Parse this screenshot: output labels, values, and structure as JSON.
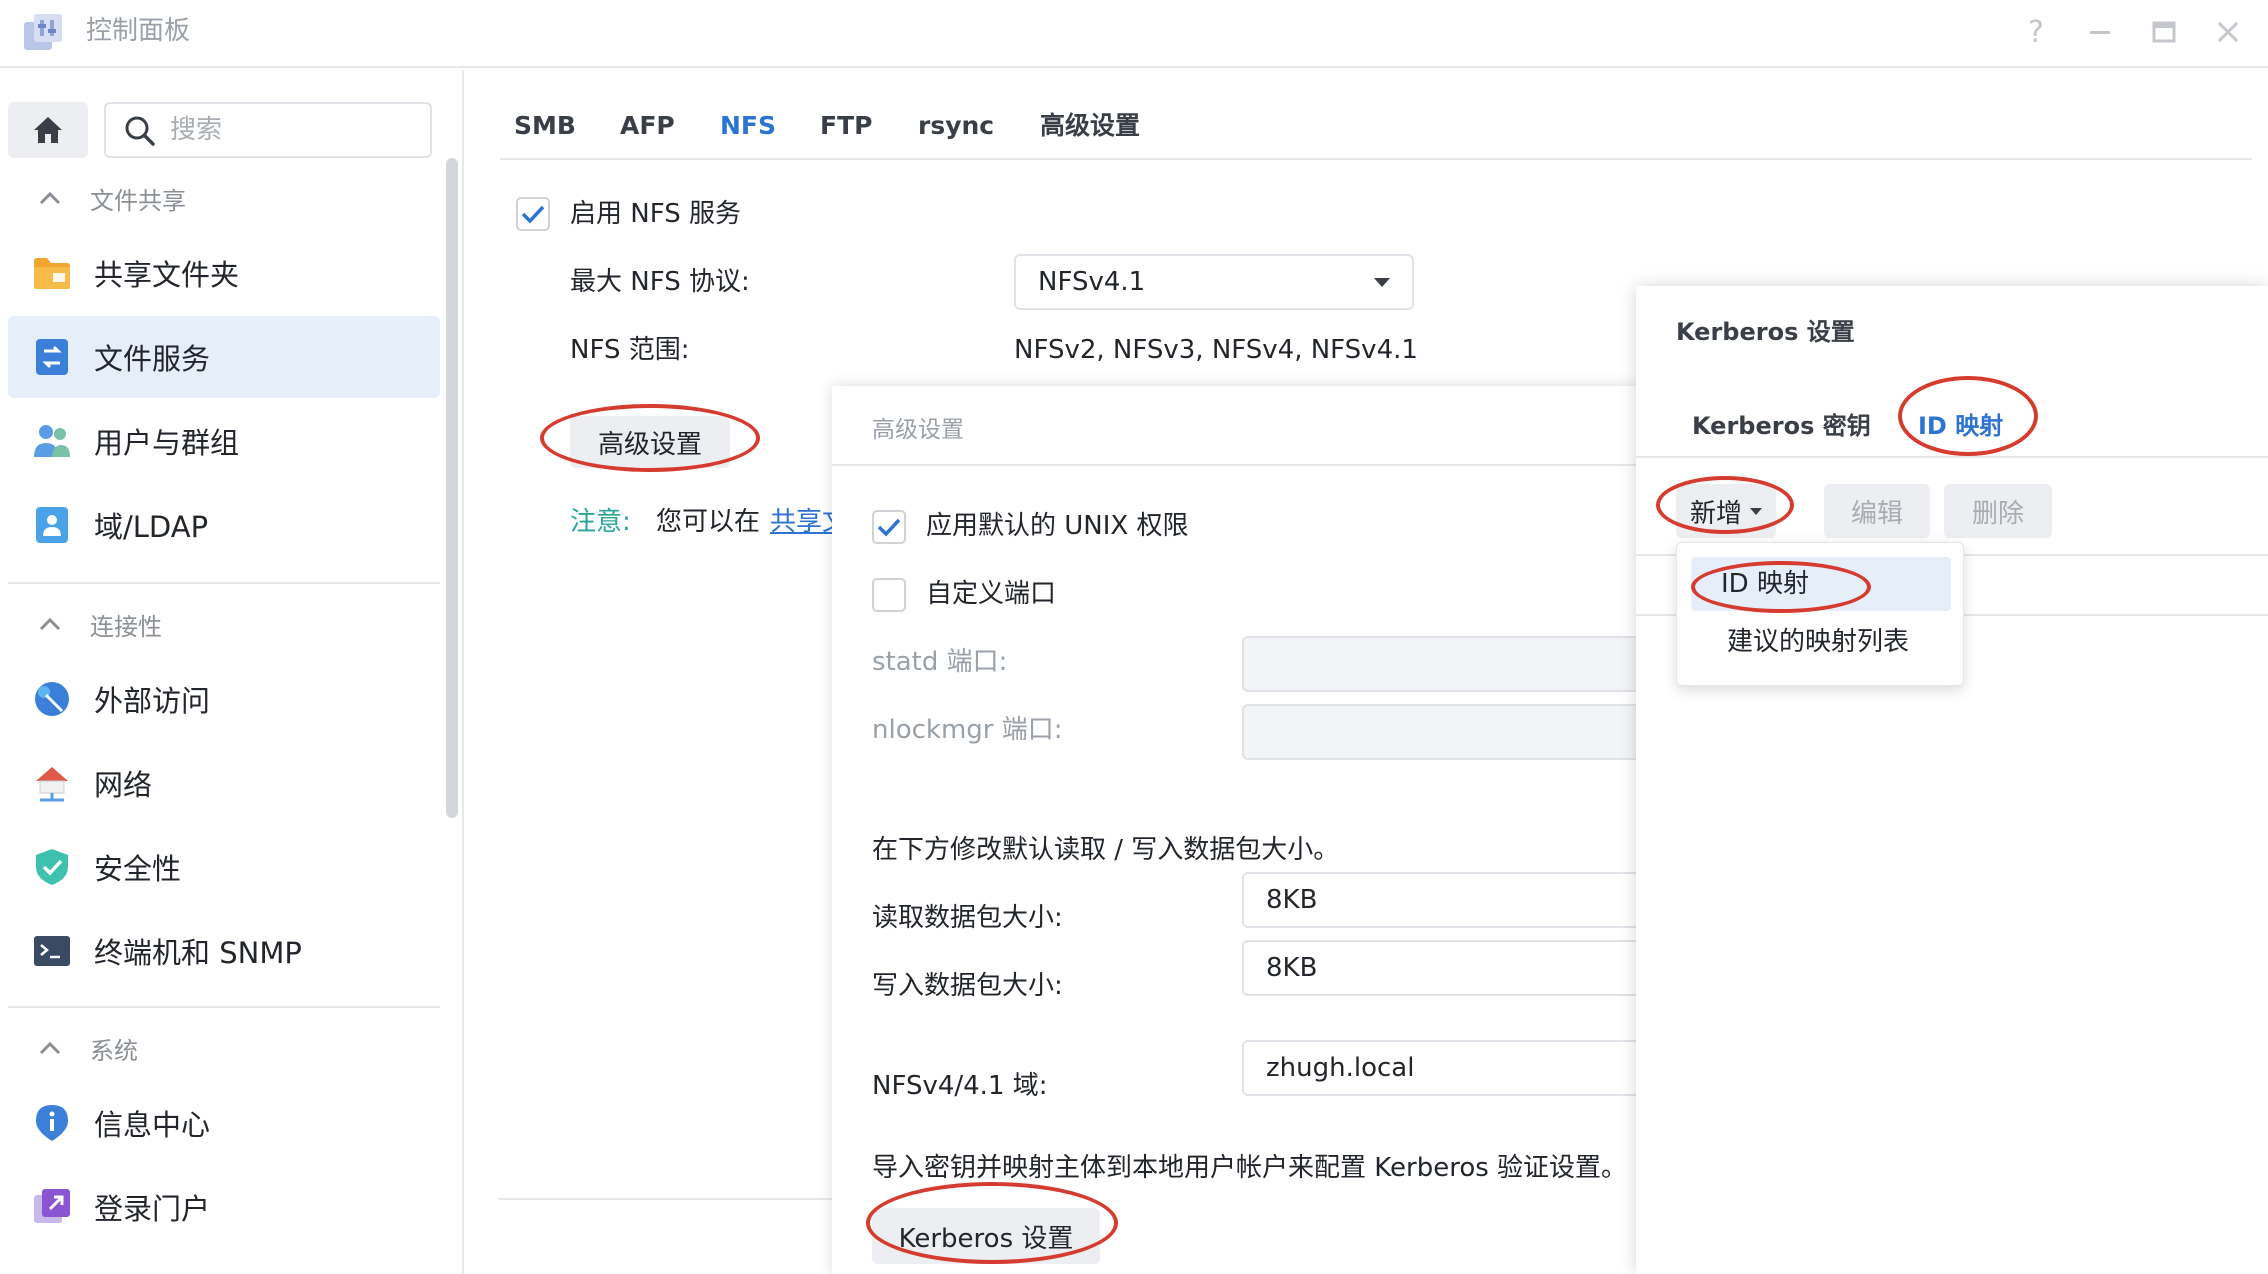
{
  "window": {
    "title": "控制面板",
    "help_icon": "help-icon",
    "minimize_icon": "minimize-icon",
    "maximize_icon": "maximize-icon",
    "close_icon": "close-icon"
  },
  "sidebar": {
    "search_placeholder": "搜索",
    "sections": [
      {
        "title": "文件共享",
        "items": [
          "共享文件夹",
          "文件服务",
          "用户与群组",
          "域/LDAP"
        ]
      },
      {
        "title": "连接性",
        "items": [
          "外部访问",
          "网络",
          "安全性",
          "终端机和 SNMP"
        ]
      },
      {
        "title": "系统",
        "items": [
          "信息中心",
          "登录门户"
        ]
      }
    ],
    "active_item": "文件服务"
  },
  "tabs": [
    "SMB",
    "AFP",
    "NFS",
    "FTP",
    "rsync",
    "高级设置"
  ],
  "active_tab": "NFS",
  "nfs": {
    "enable_label": "启用 NFS 服务",
    "enable_checked": true,
    "max_protocol_label": "最大 NFS 协议:",
    "max_protocol_value": "NFSv4.1",
    "range_label": "NFS 范围:",
    "range_value": "NFSv2, NFSv3, NFSv4, NFSv4.1",
    "advanced_button": "高级设置",
    "note_label": "注意:",
    "note_text": "您可以在",
    "note_link": "共享文"
  },
  "advanced_panel": {
    "title": "高级设置",
    "unix_perm_label": "应用默认的 UNIX 权限",
    "unix_perm_checked": true,
    "custom_port_label": "自定义端口",
    "custom_port_checked": false,
    "statd_label": "statd 端口:",
    "nlockmgr_label": "nlockmgr 端口:",
    "packet_desc": "在下方修改默认读取 / 写入数据包大小。",
    "read_label": "读取数据包大小:",
    "read_value": "8KB",
    "write_label": "写入数据包大小:",
    "write_value": "8KB",
    "domain_label": "NFSv4/4.1 域:",
    "domain_value": "zhugh.local",
    "kerberos_desc": "导入密钥并映射主体到本地用户帐户来配置 Kerberos 验证设置。",
    "kerberos_button": "Kerberos 设置"
  },
  "kerberos_panel": {
    "title": "Kerberos 设置",
    "tabs": [
      "Kerberos 密钥",
      "ID 映射"
    ],
    "active_tab": "ID 映射",
    "add_button": "新增",
    "edit_button": "编辑",
    "delete_button": "删除",
    "dropdown_items": [
      "ID 映射",
      "建议的映射列表"
    ]
  },
  "colors": {
    "accent": "#2c73d2",
    "highlight_ellipse": "#d63b2f",
    "active_nav_bg": "#e6eefa"
  }
}
